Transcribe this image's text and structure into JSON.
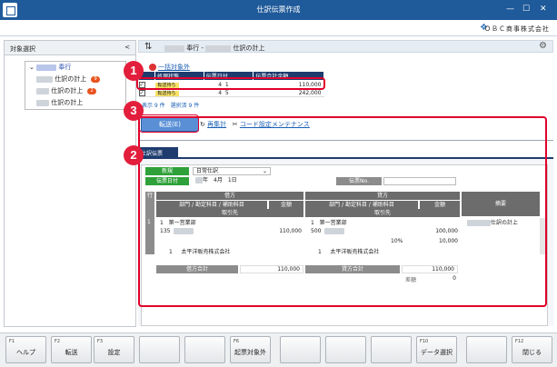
{
  "window": {
    "title": "仕訳伝票作成",
    "minimize": "—",
    "maximize": "☐",
    "close": "✕"
  },
  "brand": {
    "company": "ＯＢＣ商事株式会社"
  },
  "left_panel": {
    "title": "対象選択",
    "collapse": "<",
    "tree": [
      {
        "label": "奉行",
        "level": 0
      },
      {
        "label": "仕訳の計上",
        "badge": "9",
        "level": 1
      },
      {
        "label": "仕訳の計上",
        "badge": "2",
        "level": 1
      },
      {
        "label": "仕訳の計上",
        "badge": "",
        "level": 1
      }
    ]
  },
  "main": {
    "breadcrumb": {
      "part1": "奉行",
      "sep": "-",
      "part2": "仕訳の計上"
    },
    "bulk_exclude": "一括対象外",
    "grid": {
      "headers": [
        "処理状態",
        "伝票日付",
        "伝票合計金額"
      ],
      "rows": [
        {
          "checked": true,
          "status": "転送待ち",
          "month": "4",
          "day": "1",
          "amount": "110,000"
        },
        {
          "checked": true,
          "status": "転送待ち",
          "month": "4",
          "day": "5",
          "amount": "242,000"
        }
      ],
      "summary": "表示 9 件　選択済 9 件"
    },
    "send_button": "転送(E)",
    "recalc": "再集計",
    "code_maint": "コード設定メンテナンス",
    "voucher": {
      "tab": "仕訳伝票",
      "mode": "新規",
      "type": "日常仕訳",
      "date_label": "伝票日付",
      "date_value": "年　4月　1日",
      "voucher_no_label": "伝票No.",
      "row_label": "行",
      "debit": "借方",
      "credit": "貸方",
      "summary_col": "摘要",
      "dept_label": "部門 / 勘定科目 / 補助科目",
      "amount_label": "金額",
      "partner_label": "取引先",
      "line1": {
        "no": "1",
        "dr_dept_code": "1",
        "dr_dept": "第一営業部",
        "dr_account_code": "135",
        "dr_amount": "110,000",
        "cr_dept_code": "1",
        "cr_dept": "第一営業部",
        "cr_account_code": "500",
        "cr_amount": "100,000",
        "tax_rate": "10%",
        "tax_amount": "10,000",
        "memo": "仕訳の計上",
        "dr_partner_code": "1",
        "dr_partner": "太平洋販売株式会社",
        "cr_partner_code": "1",
        "cr_partner": "太平洋販売株式会社"
      },
      "debit_total_label": "借方合計",
      "debit_total": "110,000",
      "credit_total_label": "貸方合計",
      "credit_total": "110,000",
      "diff_label": "差額",
      "diff": "0"
    }
  },
  "callouts": [
    "1",
    "2",
    "3"
  ],
  "function_keys": [
    {
      "key": "F1",
      "label": "ヘルプ"
    },
    {
      "key": "F2",
      "label": "転送"
    },
    {
      "key": "F3",
      "label": "設定"
    },
    {
      "key": "",
      "label": ""
    },
    {
      "key": "",
      "label": ""
    },
    {
      "key": "F6",
      "label": "起票対象外"
    },
    {
      "key": "",
      "label": ""
    },
    {
      "key": "",
      "label": ""
    },
    {
      "key": "",
      "label": ""
    },
    {
      "key": "F10",
      "label": "データ選択"
    },
    {
      "key": "",
      "label": ""
    },
    {
      "key": "F12",
      "label": "閉じる"
    }
  ]
}
